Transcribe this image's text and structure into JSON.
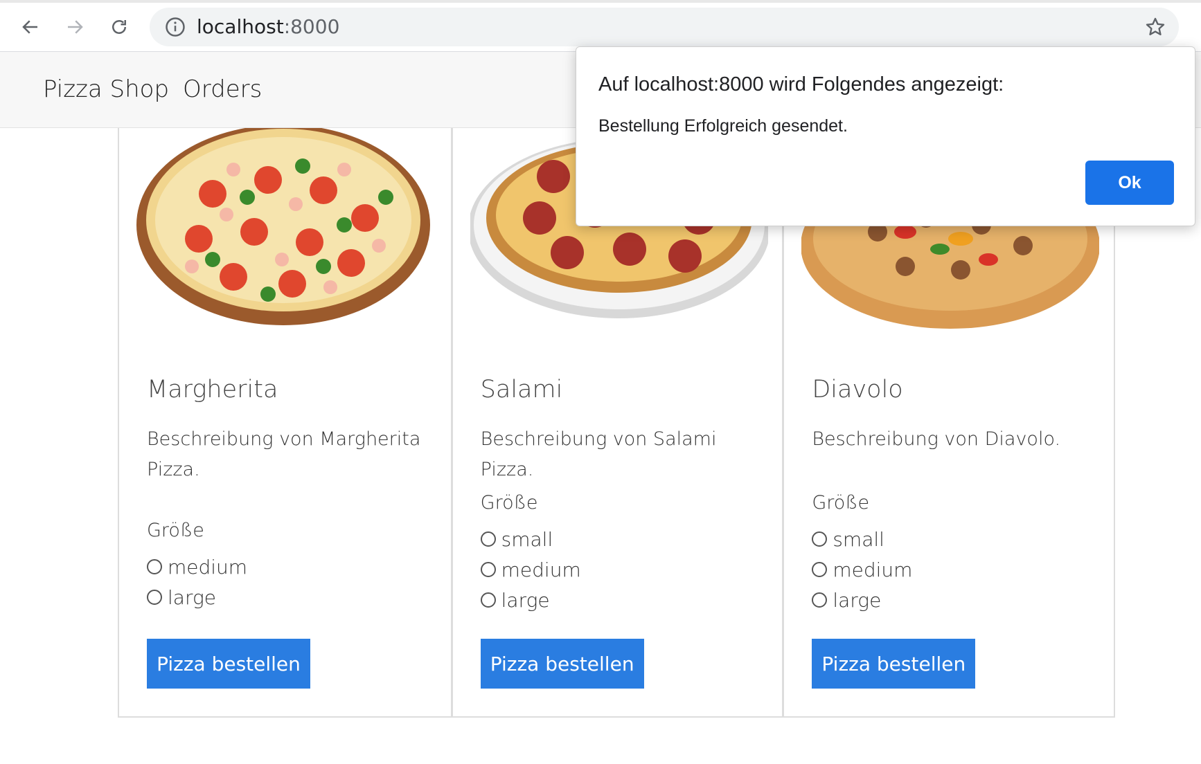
{
  "browser": {
    "url_host": "localhost",
    "url_port": ":8000",
    "icons": [
      "back-arrow-icon",
      "forward-arrow-icon",
      "reload-icon",
      "info-icon",
      "star-icon"
    ]
  },
  "nav": {
    "brand": "Pizza Shop",
    "orders": "Orders"
  },
  "pizzas": [
    {
      "name": "Margherita",
      "description": "Beschreibung von Margherita Pizza.",
      "size_label": "Größe",
      "sizes": [
        "medium",
        "large"
      ],
      "button": "Pizza bestellen"
    },
    {
      "name": "Salami",
      "description": "Beschreibung von Salami Pizza.",
      "size_label": "Größe",
      "sizes": [
        "small",
        "medium",
        "large"
      ],
      "button": "Pizza bestellen"
    },
    {
      "name": "Diavolo",
      "description": "Beschreibung von Diavolo.",
      "size_label": "Größe",
      "sizes": [
        "small",
        "medium",
        "large"
      ],
      "button": "Pizza bestellen"
    }
  ],
  "dialog": {
    "title": "Auf localhost:8000 wird Folgendes angezeigt:",
    "message": "Bestellung Erfolgreich gesendet.",
    "ok_label": "Ok"
  },
  "colors": {
    "primary_button": "#2a7de1",
    "dialog_button": "#1a73e8"
  }
}
